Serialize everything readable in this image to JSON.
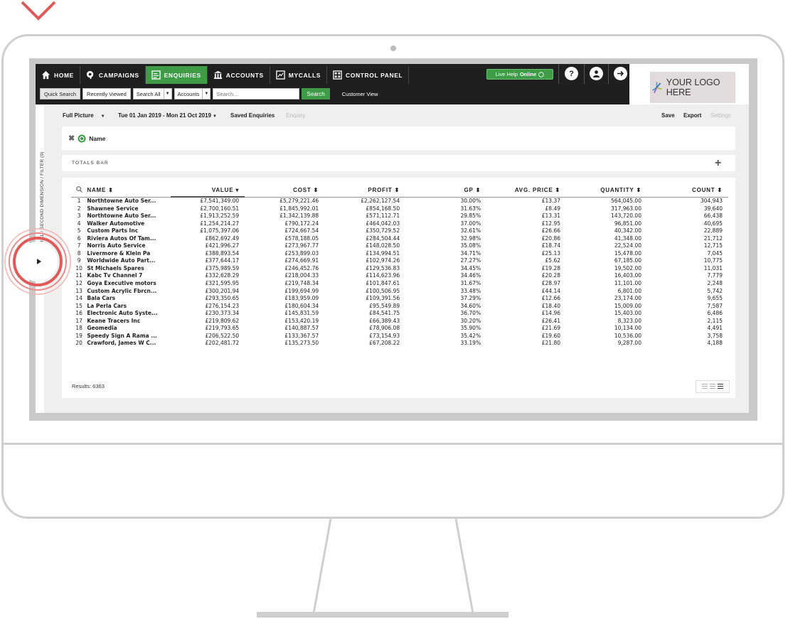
{
  "nav": {
    "tabs": [
      {
        "label": "HOME",
        "icon": "home-icon"
      },
      {
        "label": "CAMPAIGNS",
        "icon": "megaphone-icon"
      },
      {
        "label": "ENQUIRIES",
        "icon": "report-icon"
      },
      {
        "label": "ACCOUNTS",
        "icon": "bank-icon"
      },
      {
        "label": "MYCALLS",
        "icon": "chart-icon"
      },
      {
        "label": "CONTROL PANEL",
        "icon": "grid-icon"
      }
    ],
    "live_help_prefix": "Live Help",
    "live_help_status": "Online",
    "help_glyph": "?"
  },
  "subbar": {
    "quick_search": "Quick Search",
    "recently_viewed": "Recently Viewed",
    "search_all": "Search All",
    "accounts": "Accounts",
    "search_placeholder": "Search...",
    "search_button": "Search",
    "customer_view": "Customer View"
  },
  "logo": {
    "text": "YOUR LOGO HERE"
  },
  "sidebar": {
    "label": "DRILL / SECOND DIMENSION / FILTER (0)"
  },
  "toolbar": {
    "full_picture": "Full Picture",
    "date_range": "Tue 01 Jan 2019 - Mon 21 Oct 2019",
    "saved_enquiries": "Saved Enquiries",
    "enquiry": "Enquiry",
    "save": "Save",
    "export": "Export",
    "settings": "Settings"
  },
  "filter_chip": {
    "label": "Name"
  },
  "totals_bar": {
    "label": "TOTALS BAR",
    "add_glyph": "+"
  },
  "table": {
    "columns": [
      "NAME",
      "VALUE",
      "COST",
      "PROFIT",
      "GP",
      "AVG. PRICE",
      "QUANTITY",
      "COUNT"
    ],
    "rows": [
      [
        "1",
        "Northtowne Auto Ser...",
        "£7,541,349.00",
        "£5,279,221.46",
        "£2,262,127.54",
        "30.00%",
        "£13.37",
        "564,045.00",
        "304,943"
      ],
      [
        "2",
        "Shawnee Service",
        "£2,700,160.51",
        "£1,845,992.01",
        "£854,168.50",
        "31.63%",
        "£8.49",
        "317,963.00",
        "39,640"
      ],
      [
        "3",
        "Northtowne Auto Ser...",
        "£1,913,252.59",
        "£1,342,139.88",
        "£571,112.71",
        "29.85%",
        "£13.31",
        "143,720.00",
        "66,438"
      ],
      [
        "4",
        "Walker Automotive",
        "£1,254,214.27",
        "£790,172.24",
        "£464,042.03",
        "37.00%",
        "£12.95",
        "96,851.00",
        "40,695"
      ],
      [
        "5",
        "Custom Parts Inc",
        "£1,075,397.06",
        "£724,667.54",
        "£350,729.52",
        "32.61%",
        "£26.66",
        "40,342.00",
        "22,889"
      ],
      [
        "6",
        "Riviera Autos Of Tam...",
        "£862,692.49",
        "£578,188.05",
        "£284,504.44",
        "32.98%",
        "£20.86",
        "41,348.00",
        "21,712"
      ],
      [
        "7",
        "Norris Auto Service",
        "£421,996.27",
        "£273,967.77",
        "£148,028.50",
        "35.08%",
        "£18.74",
        "22,524.00",
        "12,715"
      ],
      [
        "8",
        "Livermore & Klein Pa",
        "£388,893.54",
        "£253,899.03",
        "£134,994.51",
        "34.71%",
        "£25.13",
        "15,478.00",
        "7,045"
      ],
      [
        "9",
        "Worldwide Auto Part...",
        "£377,644.17",
        "£274,669.91",
        "£102,974.26",
        "27.27%",
        "£5.62",
        "67,185.00",
        "10,775"
      ],
      [
        "10",
        "St Michaels Spares",
        "£375,989.59",
        "£246,452.76",
        "£129,536.83",
        "34.45%",
        "£19.28",
        "19,502.00",
        "11,031"
      ],
      [
        "11",
        "Kabc Tv Channel 7",
        "£332,628.29",
        "£218,004.33",
        "£114,623.96",
        "34.46%",
        "£20.28",
        "16,403.00",
        "7,779"
      ],
      [
        "12",
        "Goya Executive motors",
        "£321,595.95",
        "£219,748.34",
        "£101,847.61",
        "31.67%",
        "£28.97",
        "11,101.00",
        "2,248"
      ],
      [
        "13",
        "Custom Acrylic Fbrcn...",
        "£300,201.94",
        "£199,694.99",
        "£100,506.95",
        "33.48%",
        "£44.14",
        "6,801.00",
        "5,742"
      ],
      [
        "14",
        "Bala Cars",
        "£293,350.65",
        "£183,959.09",
        "£109,391.56",
        "37.29%",
        "£12.66",
        "23,174.00",
        "9,655"
      ],
      [
        "15",
        "La Perla Cars",
        "£276,154.23",
        "£180,604.34",
        "£95,549.89",
        "34.60%",
        "£18.40",
        "15,009.00",
        "7,587"
      ],
      [
        "16",
        "Electronic Auto Syste...",
        "£230,373.34",
        "£145,831.59",
        "£84,541.75",
        "36.70%",
        "£14.96",
        "15,403.00",
        "6,486"
      ],
      [
        "17",
        "Keane Tracers Inc",
        "£219,809.62",
        "£153,420.19",
        "£66,389.43",
        "30.20%",
        "£26.41",
        "8,323.00",
        "2,115"
      ],
      [
        "18",
        "Geomedia",
        "£219,793.65",
        "£140,887.57",
        "£78,906.08",
        "35.90%",
        "£21.69",
        "10,134.00",
        "4,491"
      ],
      [
        "19",
        "Speedy Sign A Rama ...",
        "£206,522.50",
        "£133,367.57",
        "£73,154.93",
        "35.42%",
        "£19.60",
        "10,536.00",
        "3,758"
      ],
      [
        "20",
        "Crawford, James W C...",
        "£202,481.72",
        "£135,273.50",
        "£67,208.22",
        "33.19%",
        "£21.80",
        "9,287.00",
        "4,188"
      ]
    ]
  },
  "results": "Results: 6363",
  "colors": {
    "accent": "#3e9c47",
    "nav_bg": "#1f1f1f",
    "highlight_ring": "#e05a5a"
  }
}
